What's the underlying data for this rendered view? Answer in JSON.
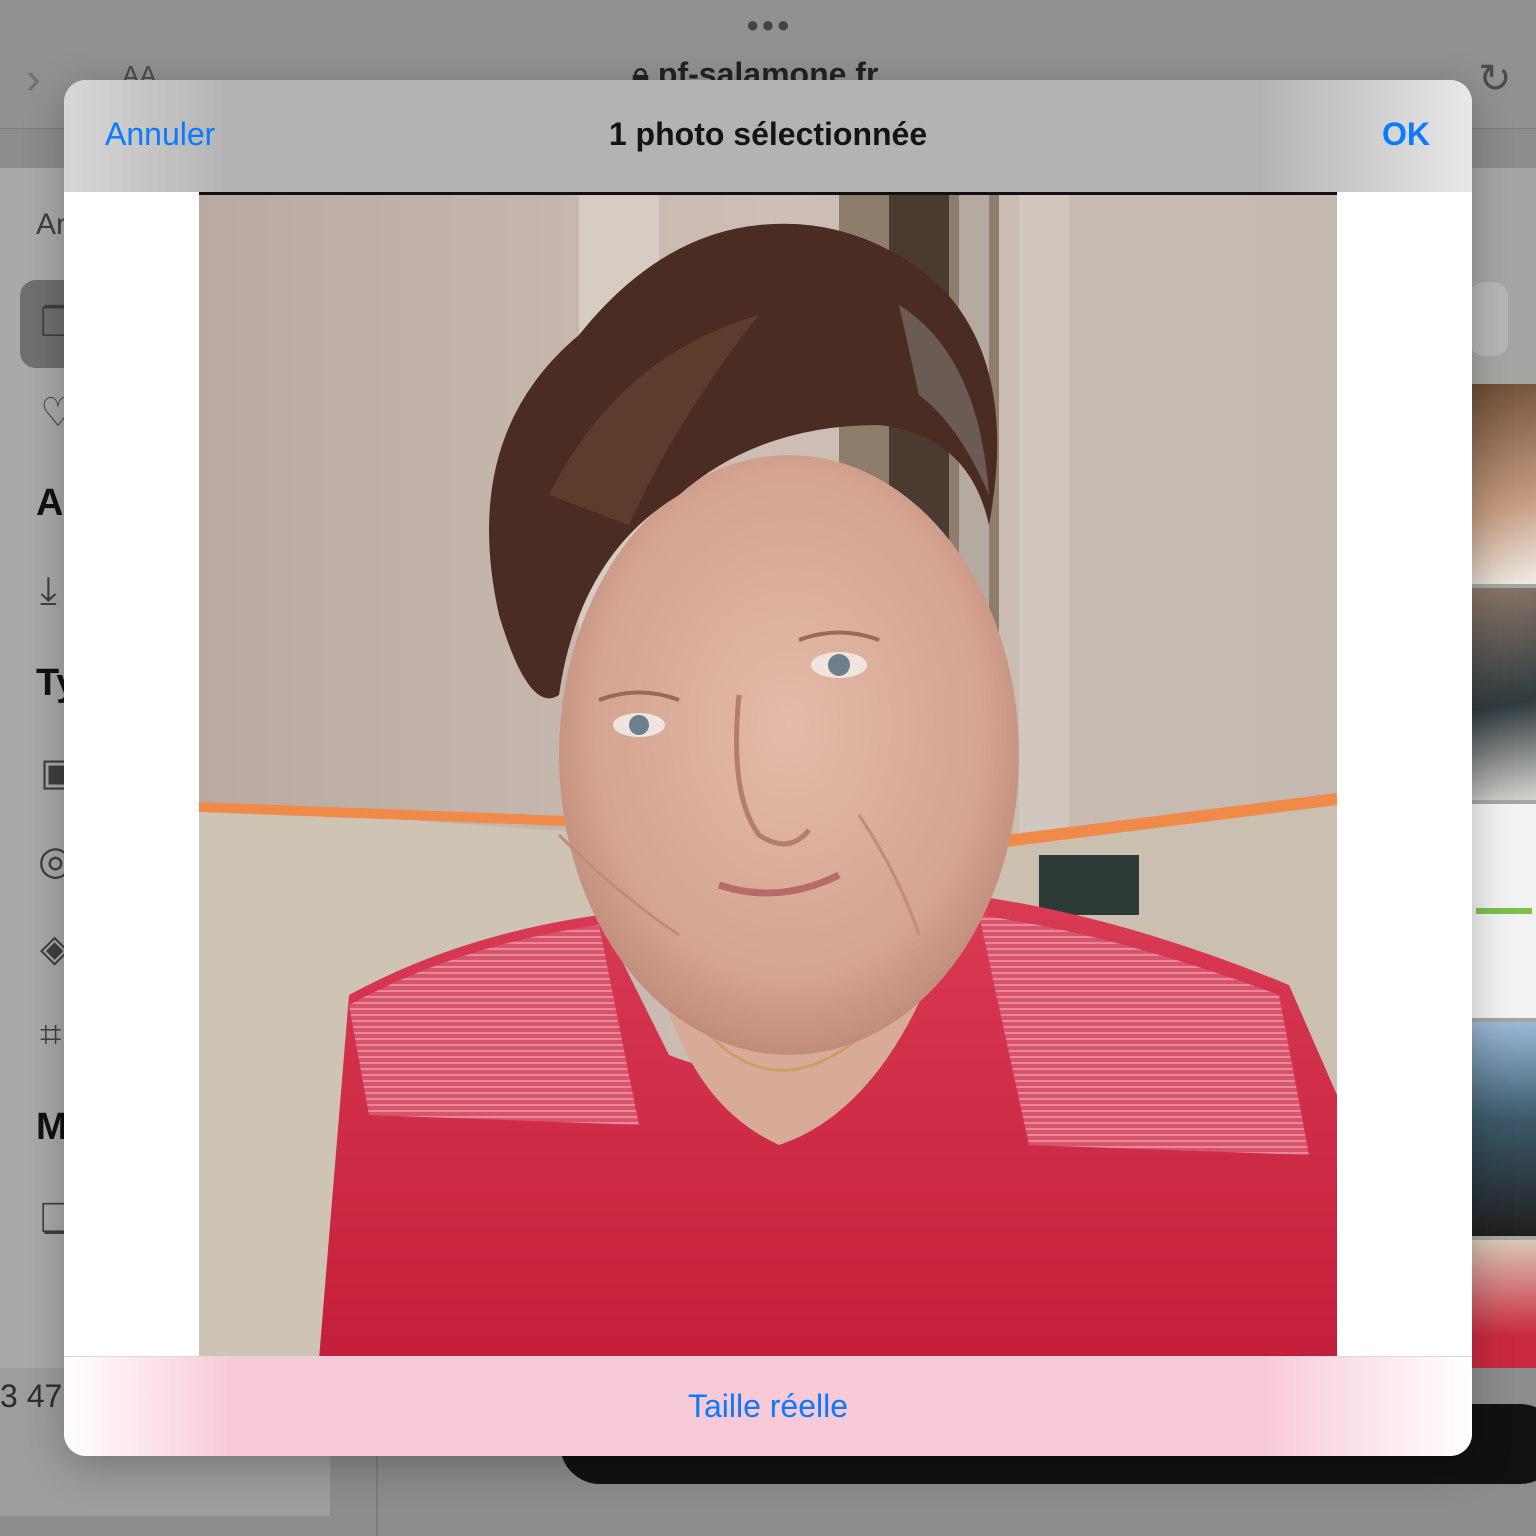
{
  "browser": {
    "url": "pf-salamone.fr",
    "text_size_label": "AA"
  },
  "background": {
    "sidebar_letters": [
      "An",
      "A",
      "Ty",
      "M"
    ],
    "item_count": "3 47"
  },
  "modal": {
    "cancel_label": "Annuler",
    "title": "1 photo sélectionnée",
    "ok_label": "OK",
    "size_option_label": "Taille réelle"
  },
  "colors": {
    "accent": "#0a7aff",
    "header_bg": "#b3b3b3",
    "footer_bg": "#f8c9d6"
  }
}
